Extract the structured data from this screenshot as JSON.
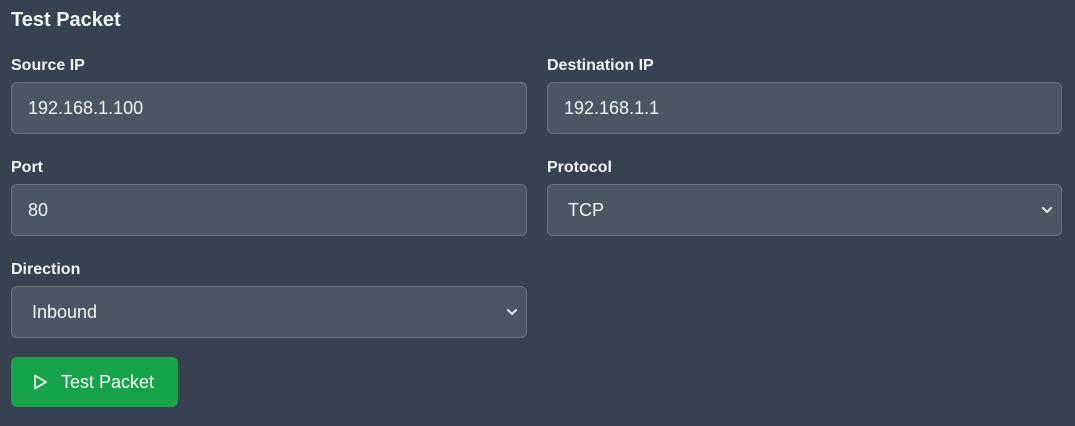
{
  "panel": {
    "title": "Test Packet"
  },
  "fields": {
    "source_ip": {
      "label": "Source IP",
      "value": "192.168.1.100"
    },
    "destination_ip": {
      "label": "Destination IP",
      "value": "192.168.1.1"
    },
    "port": {
      "label": "Port",
      "value": "80"
    },
    "protocol": {
      "label": "Protocol",
      "selected": "TCP"
    },
    "direction": {
      "label": "Direction",
      "selected": "Inbound"
    }
  },
  "actions": {
    "test_button_label": "Test Packet",
    "test_button_icon": "play-icon"
  },
  "colors": {
    "background": "#374151",
    "field_background": "#4b5563",
    "button_green": "#16a34a"
  }
}
